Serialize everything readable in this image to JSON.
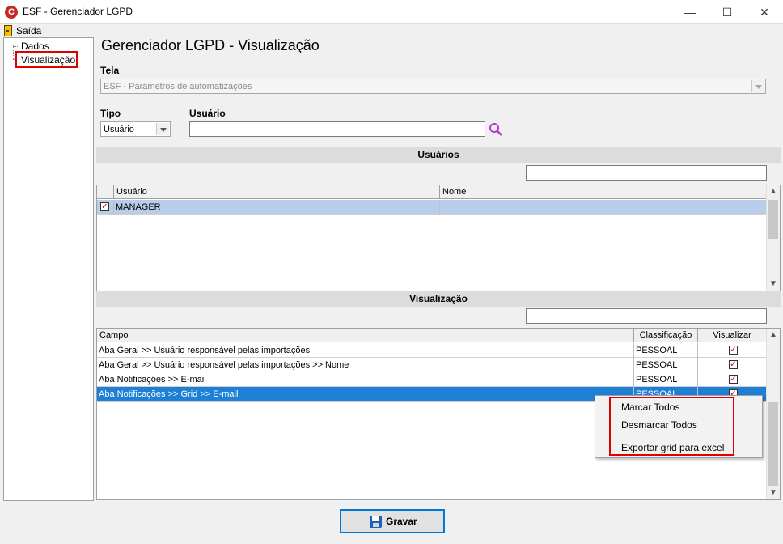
{
  "window": {
    "title": "ESF - Gerenciador LGPD",
    "logo_letter": "C",
    "minimize_glyph": "—",
    "maximize_glyph": "☐",
    "close_glyph": "✕"
  },
  "menu": {
    "exit": "Saída"
  },
  "tree": {
    "items": [
      {
        "label": "Dados"
      },
      {
        "label": "Visualização",
        "selected": true
      }
    ]
  },
  "page": {
    "title": "Gerenciador LGPD - Visualização"
  },
  "form": {
    "tela_label": "Tela",
    "tela_value": "ESF - Parâmetros de automatizações",
    "tipo_label": "Tipo",
    "tipo_value": "Usuário",
    "usuario_label": "Usuário",
    "usuario_value": ""
  },
  "usuarios_section": {
    "title": "Usuários",
    "search_value": "",
    "columns": [
      "Usuário",
      "Nome"
    ],
    "rows": [
      {
        "checked": true,
        "usuario": "MANAGER",
        "nome": ""
      }
    ]
  },
  "visualizacao_section": {
    "title": "Visualização",
    "search_value": "",
    "columns": [
      "Campo",
      "Classificação",
      "Visualizar"
    ],
    "rows": [
      {
        "campo": "Aba Geral >> Usuário responsável pelas importações",
        "classificacao": "PESSOAL",
        "visualizar": true
      },
      {
        "campo": "Aba Geral >> Usuário responsável pelas importações >> Nome",
        "classificacao": "PESSOAL",
        "visualizar": true
      },
      {
        "campo": "Aba Notificações >> E-mail",
        "classificacao": "PESSOAL",
        "visualizar": true
      },
      {
        "campo": "Aba Notificações >> Grid >> E-mail",
        "classificacao": "PESSOAL",
        "visualizar": true,
        "selected": true
      }
    ]
  },
  "context_menu": {
    "items": [
      "Marcar Todos",
      "Desmarcar Todos",
      "Exportar grid para excel"
    ]
  },
  "buttons": {
    "save": "Gravar"
  },
  "icons": {
    "search": "magnifier-icon",
    "form_search": "purple-magnifier-icon",
    "save": "floppy-disk-icon",
    "exit": "exit-door-icon"
  },
  "colors": {
    "selection_blue": "#1e7fd6",
    "selection_light": "#b8cde9",
    "highlight_red": "#e00000",
    "check_red": "#d00000"
  }
}
